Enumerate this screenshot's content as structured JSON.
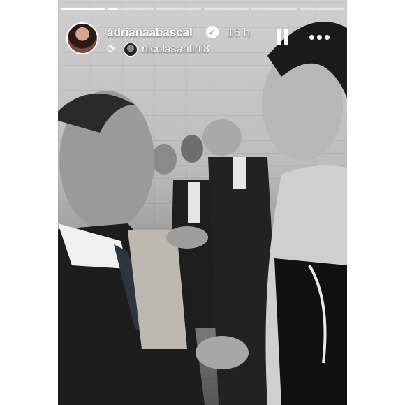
{
  "story": {
    "progress_segments": [
      1.0,
      0.2,
      0,
      0,
      0,
      0
    ],
    "author": {
      "username": "adrianaabascal",
      "verified": true,
      "posted_ago": "16 h",
      "avatar_icon": "avatar-photo"
    },
    "repost": {
      "icon": "repost-icon",
      "username": "nicolasantini8"
    },
    "controls": {
      "pause_icon": "pause-icon",
      "more_icon": "more-options-icon"
    }
  }
}
